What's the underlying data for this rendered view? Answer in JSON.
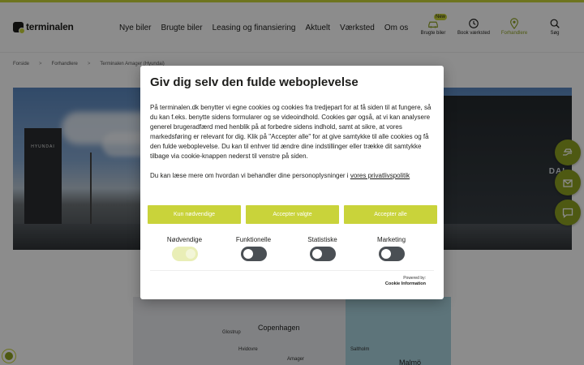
{
  "header": {
    "logo": "terminalen",
    "nav": [
      "Nye biler",
      "Brugte biler",
      "Leasing og finansiering",
      "Aktuelt",
      "Værksted",
      "Om os"
    ],
    "actions": [
      {
        "label": "Brugte biler",
        "icon": "car-icon",
        "badge": "New"
      },
      {
        "label": "Book værksted",
        "icon": "clock-icon"
      },
      {
        "label": "Forhandlere",
        "icon": "location-pin-icon"
      },
      {
        "label": "Søg",
        "icon": "search-icon"
      }
    ]
  },
  "breadcrumb": [
    "Forside",
    "Forhandlere",
    "Terminalen Amager (Hyundai)"
  ],
  "hero": {
    "pylon_text": "HYUNDAI",
    "building_sign": "DAI"
  },
  "map": {
    "labels": [
      "Copenhagen",
      "Glostrup",
      "Amager",
      "Saltholm",
      "Malmö",
      "Hvidovre"
    ]
  },
  "cookie": {
    "title": "Giv dig selv den fulde weboplevelse",
    "paragraph1": "På terminalen.dk benytter vi egne cookies og cookies fra tredjepart for at få siden til at fungere, så du kan f.eks. benytte sidens formularer og se videoindhold. Cookies gør også, at vi kan analysere generel brugeradfærd med henblik på at forbedre sidens indhold, samt at sikre, at vores markedsføring er relevant for dig. Klik på \"Accepter alle\" for at give samtykke til alle cookies og få den fulde weboplevelse. Du kan til enhver tid ændre dine indstillinger eller trække dit samtykke tilbage via cookie-knappen nederst til venstre på siden.",
    "paragraph2_prefix": "Du kan læse mere om hvordan vi behandler dine personoplysninger i ",
    "paragraph2_link": "vores privatlivspolitik",
    "buttons": {
      "necessary": "Kun nødvendige",
      "selected": "Accepter valgte",
      "all": "Accepter alle"
    },
    "toggles": [
      {
        "label": "Nødvendige",
        "on": true
      },
      {
        "label": "Funktionelle",
        "on": false
      },
      {
        "label": "Statistiske",
        "on": false
      },
      {
        "label": "Marketing",
        "on": false
      }
    ],
    "powered_by": "Powered by:",
    "powered_name": "Cookie Information"
  },
  "colors": {
    "accent": "#c9d33a",
    "accent_dark": "#8fa321",
    "text": "#1d1d1b"
  }
}
